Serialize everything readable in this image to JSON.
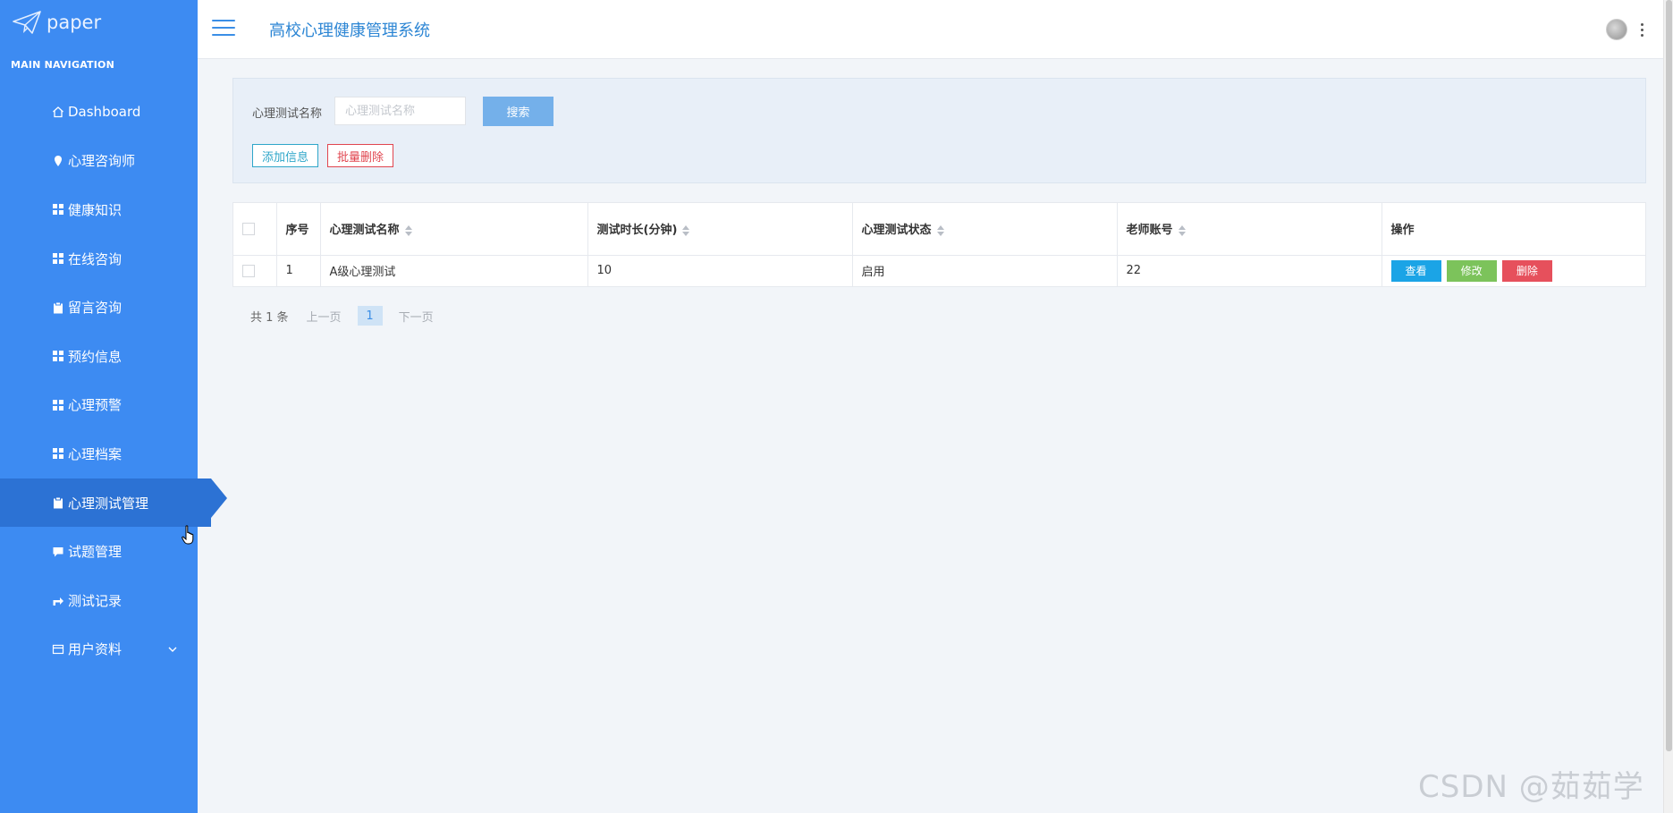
{
  "brand": {
    "name": "paper",
    "icon": "paper-plane-icon"
  },
  "sidebar": {
    "heading": "MAIN NAVIGATION",
    "items": [
      {
        "label": "Dashboard",
        "icon": "home-icon"
      },
      {
        "label": "心理咨询师",
        "icon": "map-pin-icon"
      },
      {
        "label": "健康知识",
        "icon": "grid-icon"
      },
      {
        "label": "在线咨询",
        "icon": "grid-icon"
      },
      {
        "label": "留言咨询",
        "icon": "clipboard-icon"
      },
      {
        "label": "预约信息",
        "icon": "grid-icon"
      },
      {
        "label": "心理预警",
        "icon": "grid-icon"
      },
      {
        "label": "心理档案",
        "icon": "grid-icon"
      },
      {
        "label": "心理测试管理",
        "icon": "clipboard-icon",
        "active": true
      },
      {
        "label": "试题管理",
        "icon": "comment-icon"
      },
      {
        "label": "测试记录",
        "icon": "share-icon"
      },
      {
        "label": "用户资料",
        "icon": "card-icon"
      }
    ]
  },
  "header": {
    "title": "高校心理健康管理系统"
  },
  "search": {
    "label": "心理测试名称",
    "placeholder": "心理测试名称",
    "value": "",
    "search_button": "搜索",
    "add_button": "添加信息",
    "batch_delete_button": "批量删除"
  },
  "table": {
    "columns": [
      "序号",
      "心理测试名称",
      "测试时长(分钟)",
      "心理测试状态",
      "老师账号",
      "操作"
    ],
    "rows": [
      {
        "index": "1",
        "name": "A级心理测试",
        "duration": "10",
        "status": "启用",
        "teacher": "22"
      }
    ],
    "actions": {
      "view": "查看",
      "edit": "修改",
      "delete": "删除"
    }
  },
  "pagination": {
    "total": "共 1 条",
    "prev": "上一页",
    "current": "1",
    "next": "下一页"
  },
  "watermark": "CSDN @茹茹学姐",
  "colors": {
    "sidebar": "#3d8bf2",
    "sidebar_active": "#2c72d4",
    "view": "#1ba4e6",
    "edit": "#7cc35b",
    "delete": "#e6505c",
    "title": "#2d86d4"
  }
}
